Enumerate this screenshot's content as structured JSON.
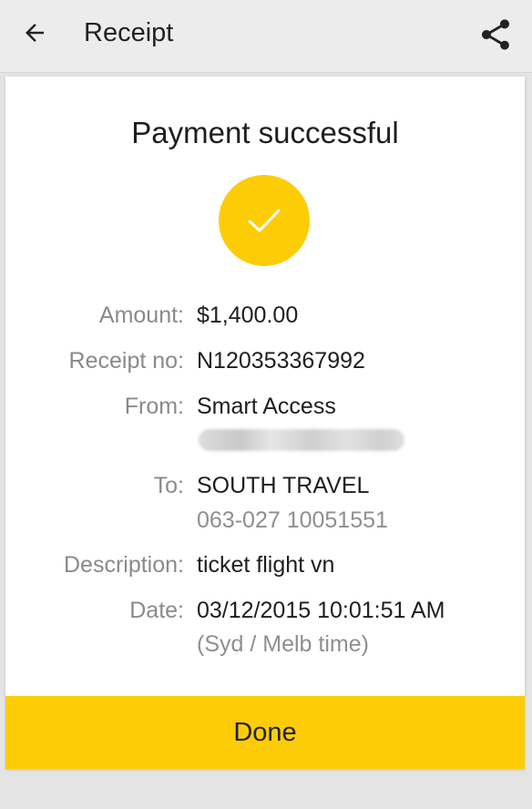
{
  "appbar": {
    "title": "Receipt",
    "back_icon": "arrow-left",
    "share_icon": "share"
  },
  "receipt": {
    "status": "Payment successful",
    "status_icon": "check",
    "accent_color": "#fccd07",
    "rows": {
      "amount": {
        "label": "Amount:",
        "value": "$1,400.00"
      },
      "receipt_no": {
        "label": "Receipt no:",
        "value": "N120353367992"
      },
      "from": {
        "label": "From:",
        "value": "Smart Access"
      },
      "to": {
        "label": "To:",
        "value": "SOUTH TRAVEL",
        "sub": "063-027 10051551"
      },
      "description": {
        "label": "Description:",
        "value": "ticket flight vn"
      },
      "date": {
        "label": "Date:",
        "value": "03/12/2015 10:01:51 AM",
        "sub": "(Syd / Melb time)"
      }
    }
  },
  "footer": {
    "done_label": "Done"
  }
}
